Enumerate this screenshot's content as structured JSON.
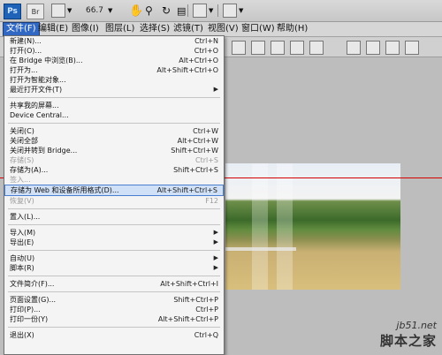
{
  "appbar": {
    "ps_label": "Ps",
    "br_label": "Br",
    "zoom": "66.7"
  },
  "menubar": [
    "文件(F)",
    "编辑(E)",
    "图像(I)",
    "图层(L)",
    "选择(S)",
    "滤镜(T)",
    "视图(V)",
    "窗口(W)",
    "帮助(H)"
  ],
  "file_menu": {
    "groups": [
      [
        {
          "label": "新建(N)...",
          "shortcut": "Ctrl+N"
        },
        {
          "label": "打开(O)...",
          "shortcut": "Ctrl+O"
        },
        {
          "label": "在 Bridge 中浏览(B)...",
          "shortcut": "Alt+Ctrl+O"
        },
        {
          "label": "打开为...",
          "shortcut": "Alt+Shift+Ctrl+O"
        },
        {
          "label": "打开为智能对象...",
          "shortcut": ""
        },
        {
          "label": "最近打开文件(T)",
          "shortcut": "",
          "submenu": true
        }
      ],
      [
        {
          "label": "共享我的屏幕...",
          "shortcut": ""
        },
        {
          "label": "Device Central...",
          "shortcut": ""
        }
      ],
      [
        {
          "label": "关闭(C)",
          "shortcut": "Ctrl+W"
        },
        {
          "label": "关闭全部",
          "shortcut": "Alt+Ctrl+W"
        },
        {
          "label": "关闭并转到 Bridge...",
          "shortcut": "Shift+Ctrl+W"
        },
        {
          "label": "存储(S)",
          "shortcut": "Ctrl+S",
          "disabled": true
        },
        {
          "label": "存储为(A)...",
          "shortcut": "Shift+Ctrl+S"
        },
        {
          "label": "签入...",
          "shortcut": "",
          "disabled": true
        },
        {
          "label": "存储为 Web 和设备所用格式(D)...",
          "shortcut": "Alt+Shift+Ctrl+S",
          "highlight": true
        },
        {
          "label": "恢复(V)",
          "shortcut": "F12",
          "disabled": true
        }
      ],
      [
        {
          "label": "置入(L)...",
          "shortcut": ""
        }
      ],
      [
        {
          "label": "导入(M)",
          "shortcut": "",
          "submenu": true
        },
        {
          "label": "导出(E)",
          "shortcut": "",
          "submenu": true
        }
      ],
      [
        {
          "label": "自动(U)",
          "shortcut": "",
          "submenu": true
        },
        {
          "label": "脚本(R)",
          "shortcut": "",
          "submenu": true
        }
      ],
      [
        {
          "label": "文件简介(F)...",
          "shortcut": "Alt+Shift+Ctrl+I"
        }
      ],
      [
        {
          "label": "页面设置(G)...",
          "shortcut": "Shift+Ctrl+P"
        },
        {
          "label": "打印(P)...",
          "shortcut": "Ctrl+P"
        },
        {
          "label": "打印一份(Y)",
          "shortcut": "Alt+Shift+Ctrl+P"
        }
      ],
      [
        {
          "label": "退出(X)",
          "shortcut": "Ctrl+Q"
        }
      ]
    ]
  },
  "watermark": {
    "url": "jb51.net",
    "name": "脚本之家"
  }
}
